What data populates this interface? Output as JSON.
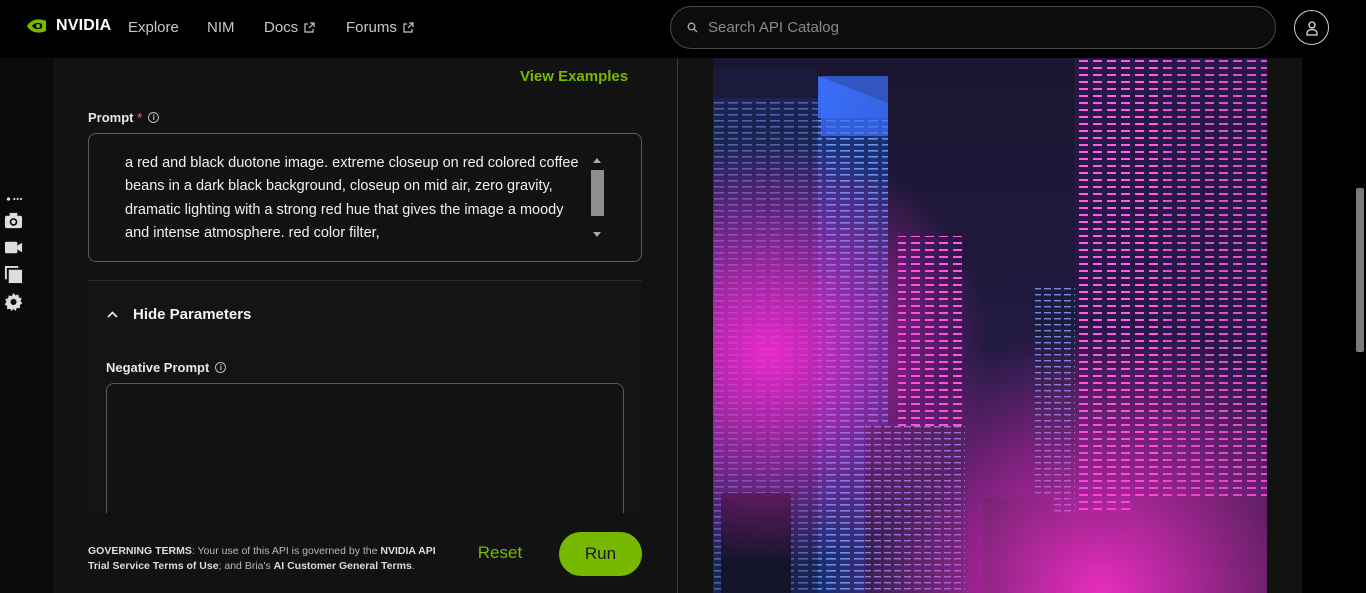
{
  "nav": {
    "brand": "NVIDIA",
    "links": [
      "Explore",
      "NIM",
      "Docs",
      "Forums"
    ],
    "search_placeholder": "Search API Catalog"
  },
  "colors": {
    "accent": "#76b900",
    "required": "#e2394f",
    "panel": "#121212"
  },
  "left_rail": {
    "icons": [
      "more-icon",
      "camera-icon",
      "video-icon",
      "gallery-icon",
      "gear-icon"
    ]
  },
  "form": {
    "view_examples": "View Examples",
    "prompt_label": "Prompt",
    "required_mark": "*",
    "prompt_text": "a red and black duotone image. extreme closeup on red colored coffee beans in a dark black background, closeup on mid air, zero gravity, dramatic lighting with a strong red hue that gives the image a moody and intense atmosphere. red color filter,",
    "params_toggle": "Hide Parameters",
    "negative_label": "Negative Prompt",
    "negative_value": ""
  },
  "footer": {
    "terms_title": "GOVERNING TERMS",
    "terms_mid": ": Your use of this API is governed by the ",
    "terms_link1": "NVIDIA API Trial Service Terms of Use",
    "terms_mid2": "; and Bria's ",
    "terms_link2": "AI Customer General Terms",
    "terms_end": ".",
    "reset": "Reset",
    "run": "Run"
  },
  "output": {
    "image": "neon city skyline"
  }
}
